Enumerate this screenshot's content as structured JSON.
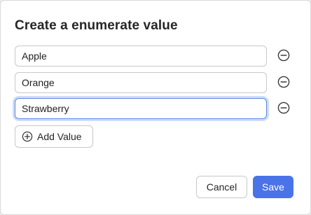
{
  "dialog": {
    "title": "Create a enumerate value"
  },
  "values": [
    {
      "value": "Apple",
      "remove_icon": "minus-circle-icon"
    },
    {
      "value": "Orange",
      "remove_icon": "minus-circle-icon"
    },
    {
      "value": "Strawberry",
      "remove_icon": "minus-circle-icon",
      "focused": true
    }
  ],
  "add_button": {
    "label": "Add Value",
    "icon": "plus-circle-icon"
  },
  "footer": {
    "cancel_label": "Cancel",
    "save_label": "Save"
  },
  "colors": {
    "accent": "#4a73e8",
    "focus_ring": "#5b86e5"
  }
}
